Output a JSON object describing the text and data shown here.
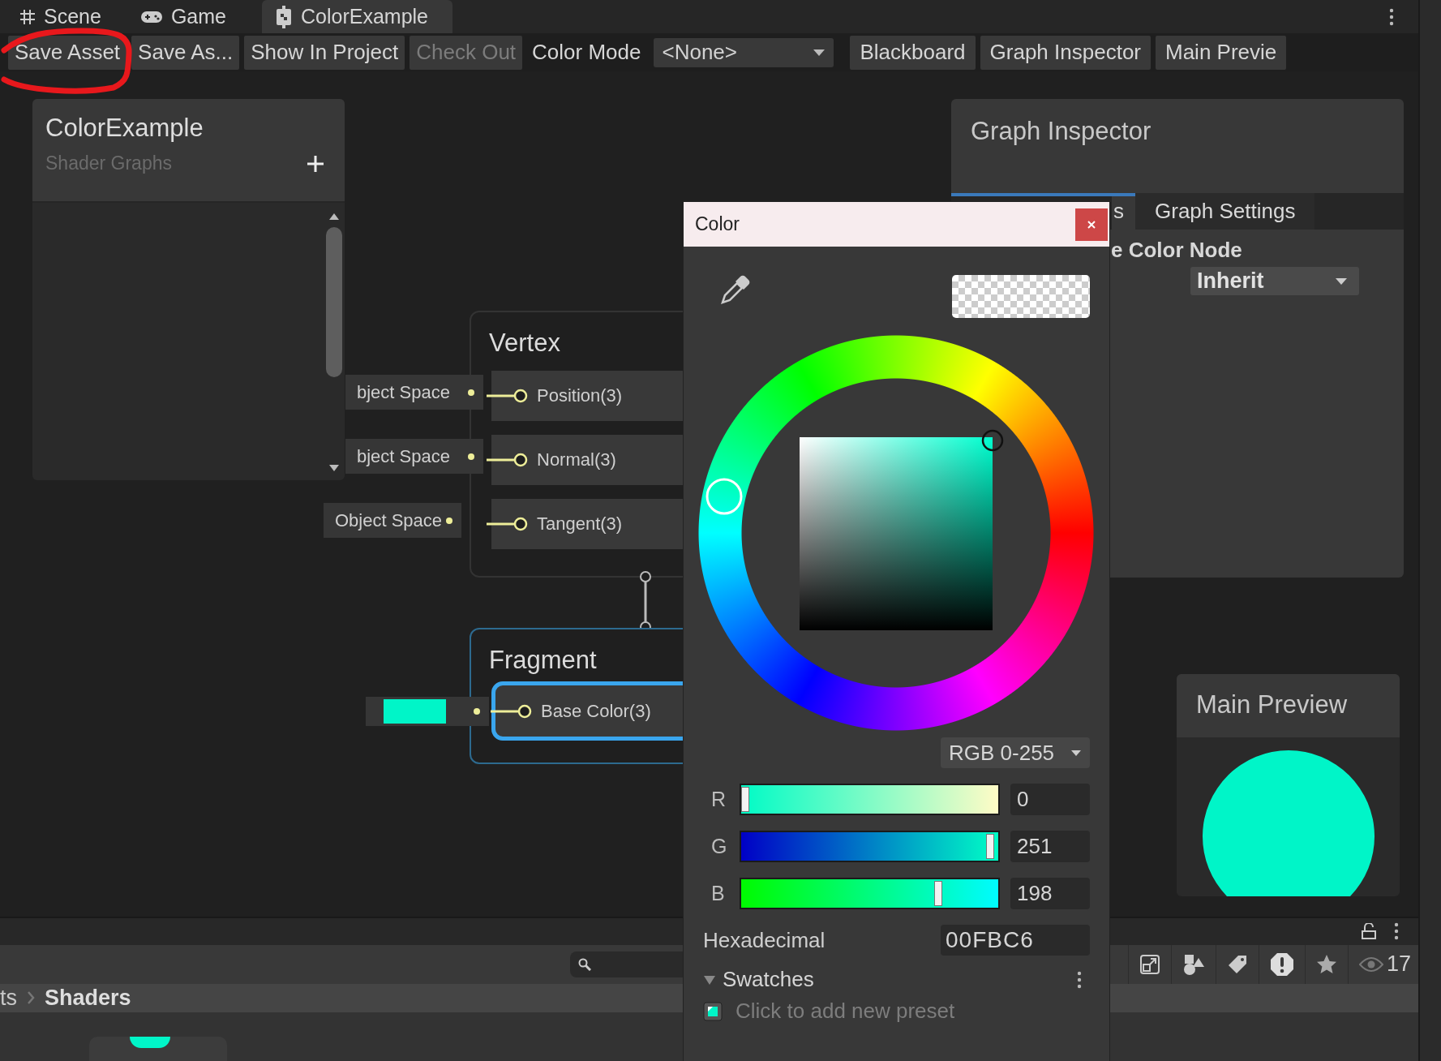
{
  "editor_tabs": [
    {
      "label": "Scene",
      "selected": false
    },
    {
      "label": "Game",
      "selected": false
    },
    {
      "label": "ColorExample",
      "selected": true
    }
  ],
  "toolbar": {
    "buttons": [
      {
        "label": "Save Asset",
        "disabled": false
      },
      {
        "label": "Save As...",
        "disabled": false
      },
      {
        "label": "Show In Project",
        "disabled": false
      },
      {
        "label": "Check Out",
        "disabled": true
      }
    ],
    "color_mode_label": "Color Mode",
    "color_mode": "<None>",
    "toggles": [
      {
        "label": "Blackboard"
      },
      {
        "label": "Graph Inspector"
      },
      {
        "label": "Main Previe"
      }
    ]
  },
  "blackboard": {
    "title": "ColorExample",
    "subtitle": "Shader Graphs"
  },
  "graph": {
    "vertex": {
      "title": "Vertex",
      "ports": [
        {
          "label": "Position(3)",
          "kind": "text",
          "input": "bject Space",
          "selected": false
        },
        {
          "label": "Normal(3)",
          "kind": "text",
          "input": "bject Space",
          "selected": false
        },
        {
          "label": "Tangent(3)",
          "kind": "text",
          "input": "Object Space",
          "selected": false
        }
      ]
    },
    "fragment": {
      "title": "Fragment",
      "ports": [
        {
          "label": "Base Color(3)",
          "kind": "color",
          "selected": true
        }
      ]
    }
  },
  "graph_inspector": {
    "title": "Graph Inspector",
    "tabs": [
      {
        "label": "s",
        "selected": true
      },
      {
        "label": "Graph Settings",
        "selected": false
      }
    ],
    "field_label": "e Color Node",
    "field_value": "Inherit"
  },
  "main_preview": {
    "title": "Main Preview"
  },
  "color_picker": {
    "title": "Color",
    "mode": "RGB 0-255",
    "channels": [
      {
        "label": "R",
        "value": "0",
        "level": 0
      },
      {
        "label": "G",
        "value": "251",
        "level": 0.984
      },
      {
        "label": "B",
        "value": "198",
        "level": 0.776
      }
    ],
    "hex_label": "Hexadecimal",
    "hex_value": "00FBC6",
    "swatches": {
      "title": "Swatches",
      "expanded": true,
      "hint": "Click to add new preset"
    }
  },
  "project": {
    "breadcrumb": [
      {
        "label": "ts",
        "selected": false
      },
      {
        "label": "Shaders",
        "selected": true
      }
    ],
    "hidden_count": "17"
  }
}
